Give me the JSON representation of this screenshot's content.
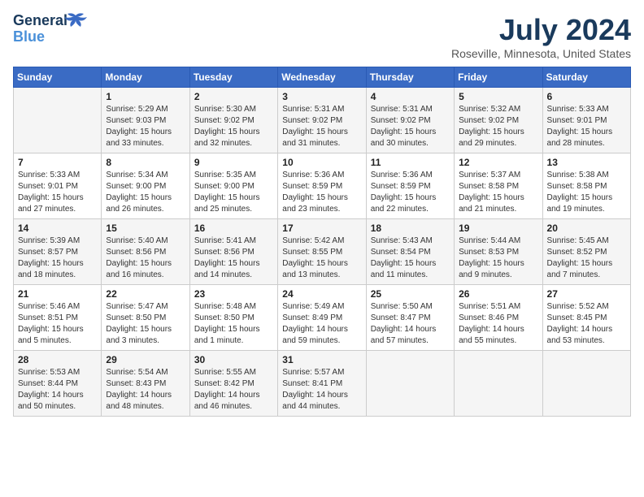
{
  "header": {
    "logo_line1": "General",
    "logo_line2": "Blue",
    "month_year": "July 2024",
    "location": "Roseville, Minnesota, United States"
  },
  "days_of_week": [
    "Sunday",
    "Monday",
    "Tuesday",
    "Wednesday",
    "Thursday",
    "Friday",
    "Saturday"
  ],
  "weeks": [
    [
      {
        "day": "",
        "info": ""
      },
      {
        "day": "1",
        "info": "Sunrise: 5:29 AM\nSunset: 9:03 PM\nDaylight: 15 hours\nand 33 minutes."
      },
      {
        "day": "2",
        "info": "Sunrise: 5:30 AM\nSunset: 9:02 PM\nDaylight: 15 hours\nand 32 minutes."
      },
      {
        "day": "3",
        "info": "Sunrise: 5:31 AM\nSunset: 9:02 PM\nDaylight: 15 hours\nand 31 minutes."
      },
      {
        "day": "4",
        "info": "Sunrise: 5:31 AM\nSunset: 9:02 PM\nDaylight: 15 hours\nand 30 minutes."
      },
      {
        "day": "5",
        "info": "Sunrise: 5:32 AM\nSunset: 9:02 PM\nDaylight: 15 hours\nand 29 minutes."
      },
      {
        "day": "6",
        "info": "Sunrise: 5:33 AM\nSunset: 9:01 PM\nDaylight: 15 hours\nand 28 minutes."
      }
    ],
    [
      {
        "day": "7",
        "info": "Sunrise: 5:33 AM\nSunset: 9:01 PM\nDaylight: 15 hours\nand 27 minutes."
      },
      {
        "day": "8",
        "info": "Sunrise: 5:34 AM\nSunset: 9:00 PM\nDaylight: 15 hours\nand 26 minutes."
      },
      {
        "day": "9",
        "info": "Sunrise: 5:35 AM\nSunset: 9:00 PM\nDaylight: 15 hours\nand 25 minutes."
      },
      {
        "day": "10",
        "info": "Sunrise: 5:36 AM\nSunset: 8:59 PM\nDaylight: 15 hours\nand 23 minutes."
      },
      {
        "day": "11",
        "info": "Sunrise: 5:36 AM\nSunset: 8:59 PM\nDaylight: 15 hours\nand 22 minutes."
      },
      {
        "day": "12",
        "info": "Sunrise: 5:37 AM\nSunset: 8:58 PM\nDaylight: 15 hours\nand 21 minutes."
      },
      {
        "day": "13",
        "info": "Sunrise: 5:38 AM\nSunset: 8:58 PM\nDaylight: 15 hours\nand 19 minutes."
      }
    ],
    [
      {
        "day": "14",
        "info": "Sunrise: 5:39 AM\nSunset: 8:57 PM\nDaylight: 15 hours\nand 18 minutes."
      },
      {
        "day": "15",
        "info": "Sunrise: 5:40 AM\nSunset: 8:56 PM\nDaylight: 15 hours\nand 16 minutes."
      },
      {
        "day": "16",
        "info": "Sunrise: 5:41 AM\nSunset: 8:56 PM\nDaylight: 15 hours\nand 14 minutes."
      },
      {
        "day": "17",
        "info": "Sunrise: 5:42 AM\nSunset: 8:55 PM\nDaylight: 15 hours\nand 13 minutes."
      },
      {
        "day": "18",
        "info": "Sunrise: 5:43 AM\nSunset: 8:54 PM\nDaylight: 15 hours\nand 11 minutes."
      },
      {
        "day": "19",
        "info": "Sunrise: 5:44 AM\nSunset: 8:53 PM\nDaylight: 15 hours\nand 9 minutes."
      },
      {
        "day": "20",
        "info": "Sunrise: 5:45 AM\nSunset: 8:52 PM\nDaylight: 15 hours\nand 7 minutes."
      }
    ],
    [
      {
        "day": "21",
        "info": "Sunrise: 5:46 AM\nSunset: 8:51 PM\nDaylight: 15 hours\nand 5 minutes."
      },
      {
        "day": "22",
        "info": "Sunrise: 5:47 AM\nSunset: 8:50 PM\nDaylight: 15 hours\nand 3 minutes."
      },
      {
        "day": "23",
        "info": "Sunrise: 5:48 AM\nSunset: 8:50 PM\nDaylight: 15 hours\nand 1 minute."
      },
      {
        "day": "24",
        "info": "Sunrise: 5:49 AM\nSunset: 8:49 PM\nDaylight: 14 hours\nand 59 minutes."
      },
      {
        "day": "25",
        "info": "Sunrise: 5:50 AM\nSunset: 8:47 PM\nDaylight: 14 hours\nand 57 minutes."
      },
      {
        "day": "26",
        "info": "Sunrise: 5:51 AM\nSunset: 8:46 PM\nDaylight: 14 hours\nand 55 minutes."
      },
      {
        "day": "27",
        "info": "Sunrise: 5:52 AM\nSunset: 8:45 PM\nDaylight: 14 hours\nand 53 minutes."
      }
    ],
    [
      {
        "day": "28",
        "info": "Sunrise: 5:53 AM\nSunset: 8:44 PM\nDaylight: 14 hours\nand 50 minutes."
      },
      {
        "day": "29",
        "info": "Sunrise: 5:54 AM\nSunset: 8:43 PM\nDaylight: 14 hours\nand 48 minutes."
      },
      {
        "day": "30",
        "info": "Sunrise: 5:55 AM\nSunset: 8:42 PM\nDaylight: 14 hours\nand 46 minutes."
      },
      {
        "day": "31",
        "info": "Sunrise: 5:57 AM\nSunset: 8:41 PM\nDaylight: 14 hours\nand 44 minutes."
      },
      {
        "day": "",
        "info": ""
      },
      {
        "day": "",
        "info": ""
      },
      {
        "day": "",
        "info": ""
      }
    ]
  ]
}
